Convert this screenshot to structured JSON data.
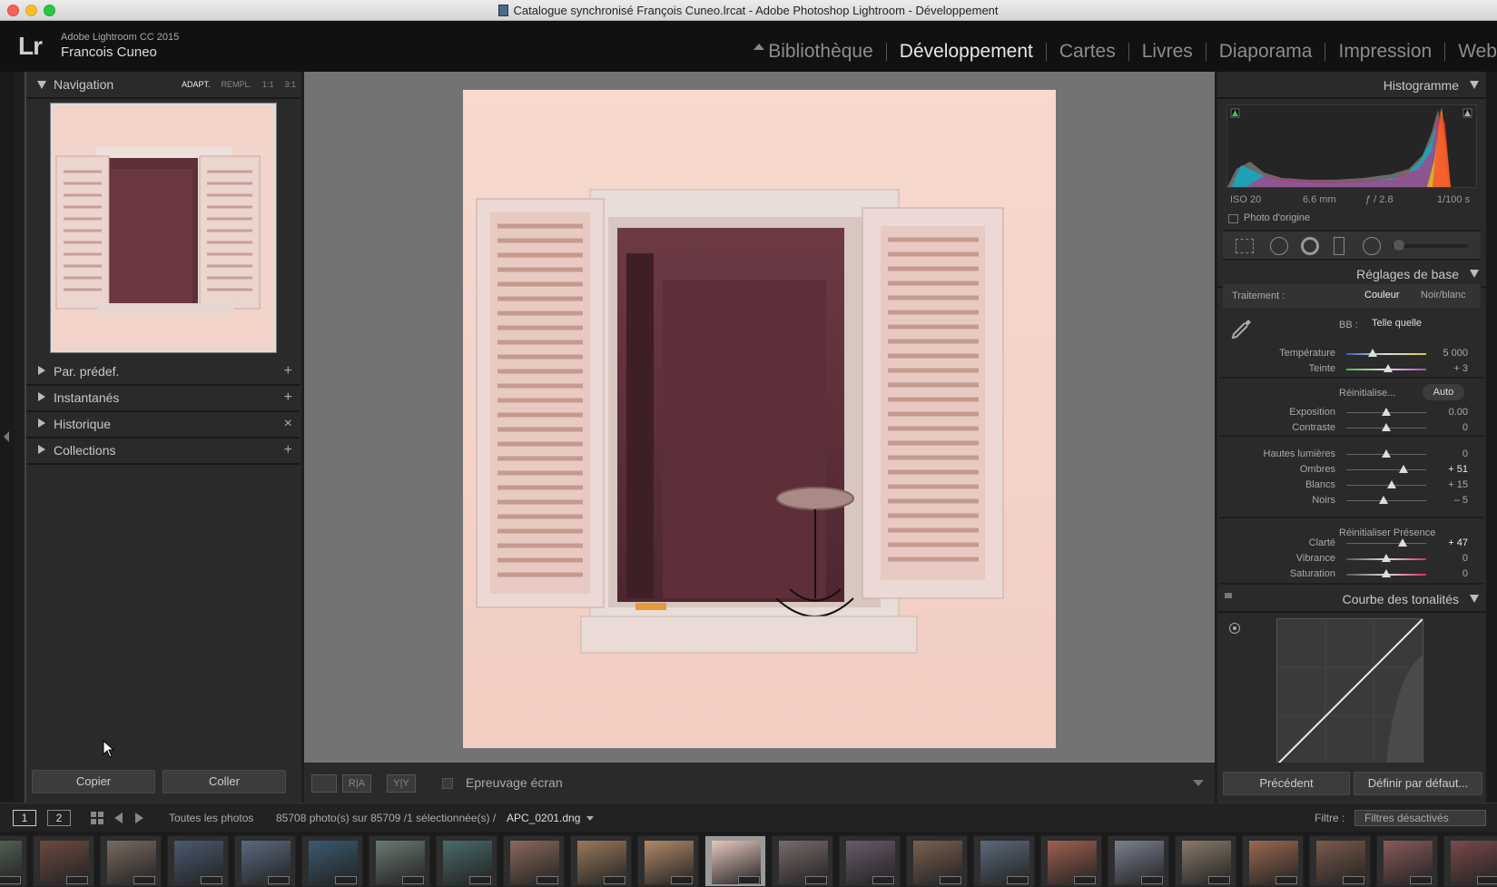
{
  "window": {
    "title": "Catalogue synchronisé François Cuneo.lrcat - Adobe Photoshop Lightroom - Développement"
  },
  "header": {
    "logo": "Lr",
    "app_name": "Adobe Lightroom CC 2015",
    "user": "Francois Cuneo",
    "modules": [
      "Bibliothèque",
      "Développement",
      "Cartes",
      "Livres",
      "Diaporama",
      "Impression",
      "Web"
    ],
    "active_module": "Développement"
  },
  "left_panel": {
    "navigation_title": "Navigation",
    "zoom_options": [
      "ADAPT.",
      "REMPL.",
      "1:1",
      "3:1"
    ],
    "panels": [
      {
        "label": "Par. prédef.",
        "action": "+"
      },
      {
        "label": "Instantanés",
        "action": "+"
      },
      {
        "label": "Historique",
        "action": "×"
      },
      {
        "label": "Collections",
        "action": "+"
      }
    ],
    "copy_label": "Copier",
    "paste_label": "Coller"
  },
  "toolbar": {
    "view_ra": "R|A",
    "view_yy": "Y|Y",
    "soft_proof": "Epreuvage écran"
  },
  "right_panel": {
    "histogram_title": "Histogramme",
    "meta": {
      "iso": "ISO 20",
      "focal": "6.6 mm",
      "aperture": "ƒ / 2.8",
      "shutter": "1/100 s"
    },
    "original_photo": "Photo d'origine",
    "basic_title": "Réglages de base",
    "treatment_label": "Traitement :",
    "color_label": "Couleur",
    "bw_label": "Noir/blanc",
    "wb_label": "BB :",
    "wb_value": "Telle quelle",
    "reset_label": "Réinitialise...",
    "auto_label": "Auto",
    "presence_reset": "Réinitialiser Présence",
    "sliders": [
      {
        "label": "Température",
        "value": "5 000",
        "pos": 0.33,
        "gradient": "temp"
      },
      {
        "label": "Teinte",
        "value": "+ 3",
        "pos": 0.52,
        "gradient": "tint"
      },
      {
        "label": "Exposition",
        "value": "0.00",
        "pos": 0.5
      },
      {
        "label": "Contraste",
        "value": "0",
        "pos": 0.5
      },
      {
        "label": "Hautes lumières",
        "value": "0",
        "pos": 0.5
      },
      {
        "label": "Ombres",
        "value": "+ 51",
        "pos": 0.72,
        "strong": true
      },
      {
        "label": "Blancs",
        "value": "+ 15",
        "pos": 0.57
      },
      {
        "label": "Noirs",
        "value": "– 5",
        "pos": 0.47
      },
      {
        "label": "Clarté",
        "value": "+ 47",
        "pos": 0.7,
        "strong": true
      },
      {
        "label": "Vibrance",
        "value": "0",
        "pos": 0.5,
        "gradient": "sat"
      },
      {
        "label": "Saturation",
        "value": "0",
        "pos": 0.5,
        "gradient": "sat"
      }
    ],
    "tone_curve_title": "Courbe des tonalités",
    "prev_label": "Précédent",
    "default_label": "Définir par défaut..."
  },
  "filmstrip_bar": {
    "screen1": "1",
    "screen2": "2",
    "source": "Toutes les photos",
    "count": "85708 photo(s) sur 85709 /1 sélectionnée(s) /",
    "filename": "APC_0201.dng",
    "filter_label": "Filtre :",
    "filter_value": "Filtres désactivés"
  },
  "colors": {
    "background": "#1e1e1e",
    "panel": "#2a2a2a",
    "center": "#737373",
    "wall": "#f5d6cc"
  }
}
